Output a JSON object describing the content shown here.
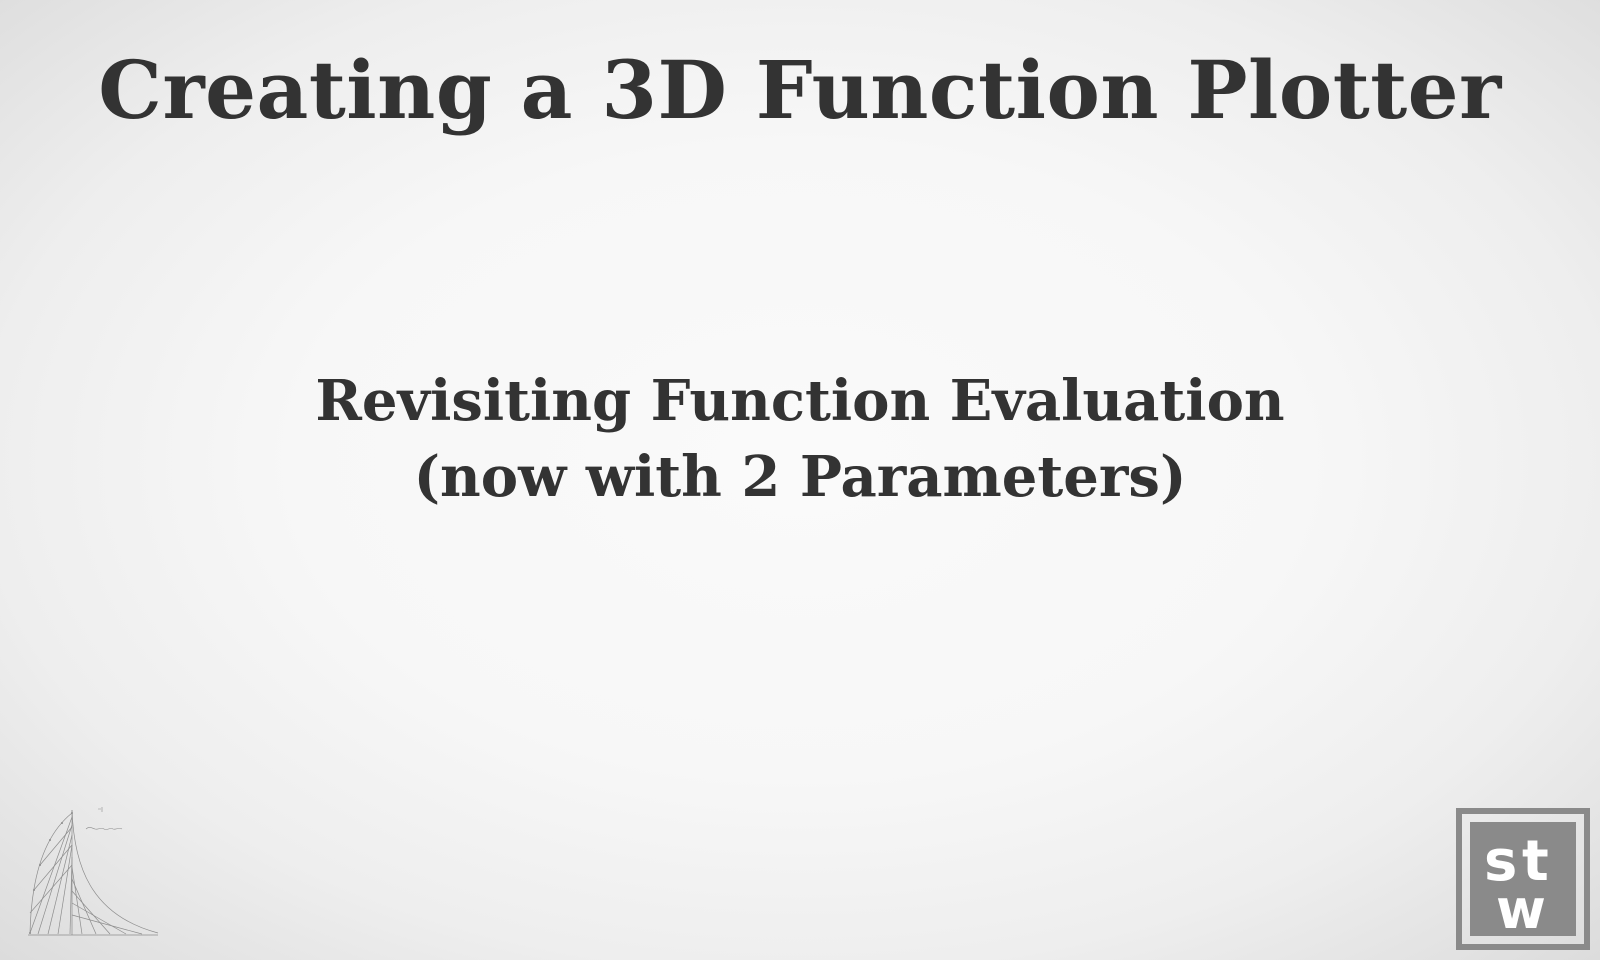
{
  "slide": {
    "title": "Creating a 3D Function Plotter",
    "subtitle_line1": "Revisiting Function Evaluation",
    "subtitle_line2": "(now with 2 Parameters)"
  },
  "decor": {
    "corner_sketch": "curve-sketch-icon",
    "logo_letters": [
      "s",
      "t",
      "w"
    ]
  },
  "colors": {
    "text": "#333333",
    "logo": "#8a8a8a"
  }
}
